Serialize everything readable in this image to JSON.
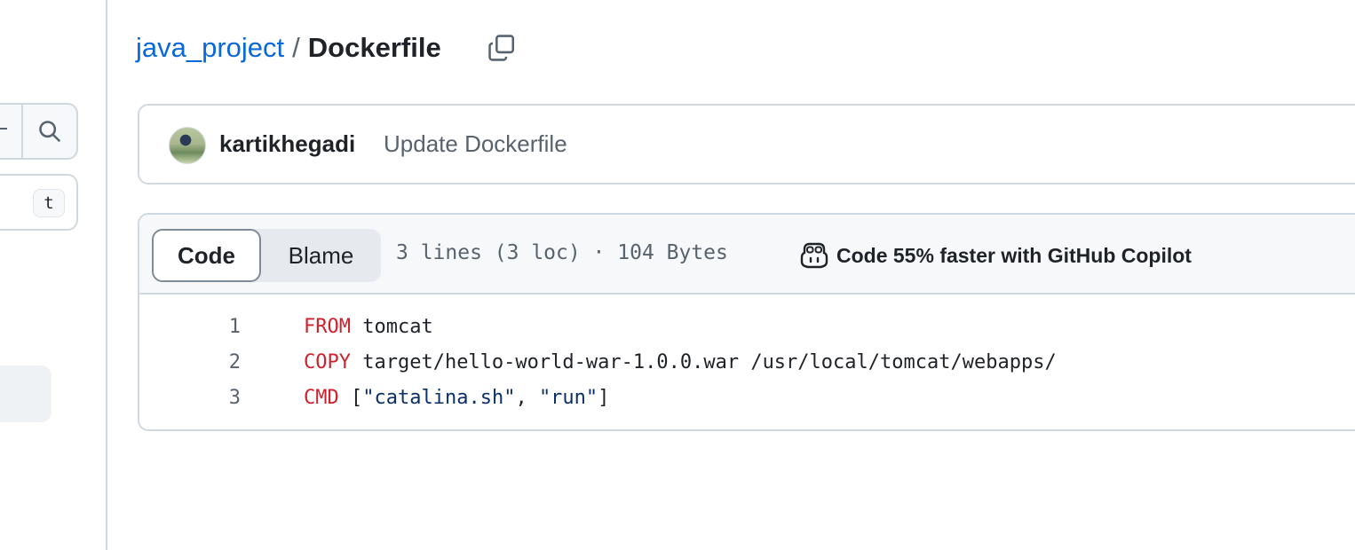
{
  "sidebar": {
    "shortcut_key": "t"
  },
  "breadcrumb": {
    "repo": "java_project",
    "separator": "/",
    "file": "Dockerfile"
  },
  "commit": {
    "author": "kartikhegadi",
    "message": "Update Dockerfile"
  },
  "file_header": {
    "tabs": [
      {
        "label": "Code",
        "selected": true
      },
      {
        "label": "Blame",
        "selected": false
      }
    ],
    "meta": "3 lines (3 loc) · 104 Bytes",
    "copilot_text": "Code 55% faster with GitHub Copilot"
  },
  "code": {
    "lines": [
      {
        "number": "1",
        "keyword": "FROM",
        "segments": [
          {
            "text": " tomcat",
            "type": "plain"
          }
        ]
      },
      {
        "number": "2",
        "keyword": "COPY",
        "segments": [
          {
            "text": " target/hello-world-war-1.0.0.war /usr/local/tomcat/webapps/",
            "type": "plain"
          }
        ]
      },
      {
        "number": "3",
        "keyword": "CMD",
        "segments": [
          {
            "text": " [",
            "type": "plain"
          },
          {
            "text": "\"catalina.sh\"",
            "type": "string"
          },
          {
            "text": ", ",
            "type": "plain"
          },
          {
            "text": "\"run\"",
            "type": "string"
          },
          {
            "text": "]",
            "type": "plain"
          }
        ]
      }
    ]
  },
  "colors": {
    "link": "#0969da",
    "keyword": "#cf222e",
    "string": "#0a3069",
    "muted": "#59636e",
    "border": "#d1d9e0"
  }
}
